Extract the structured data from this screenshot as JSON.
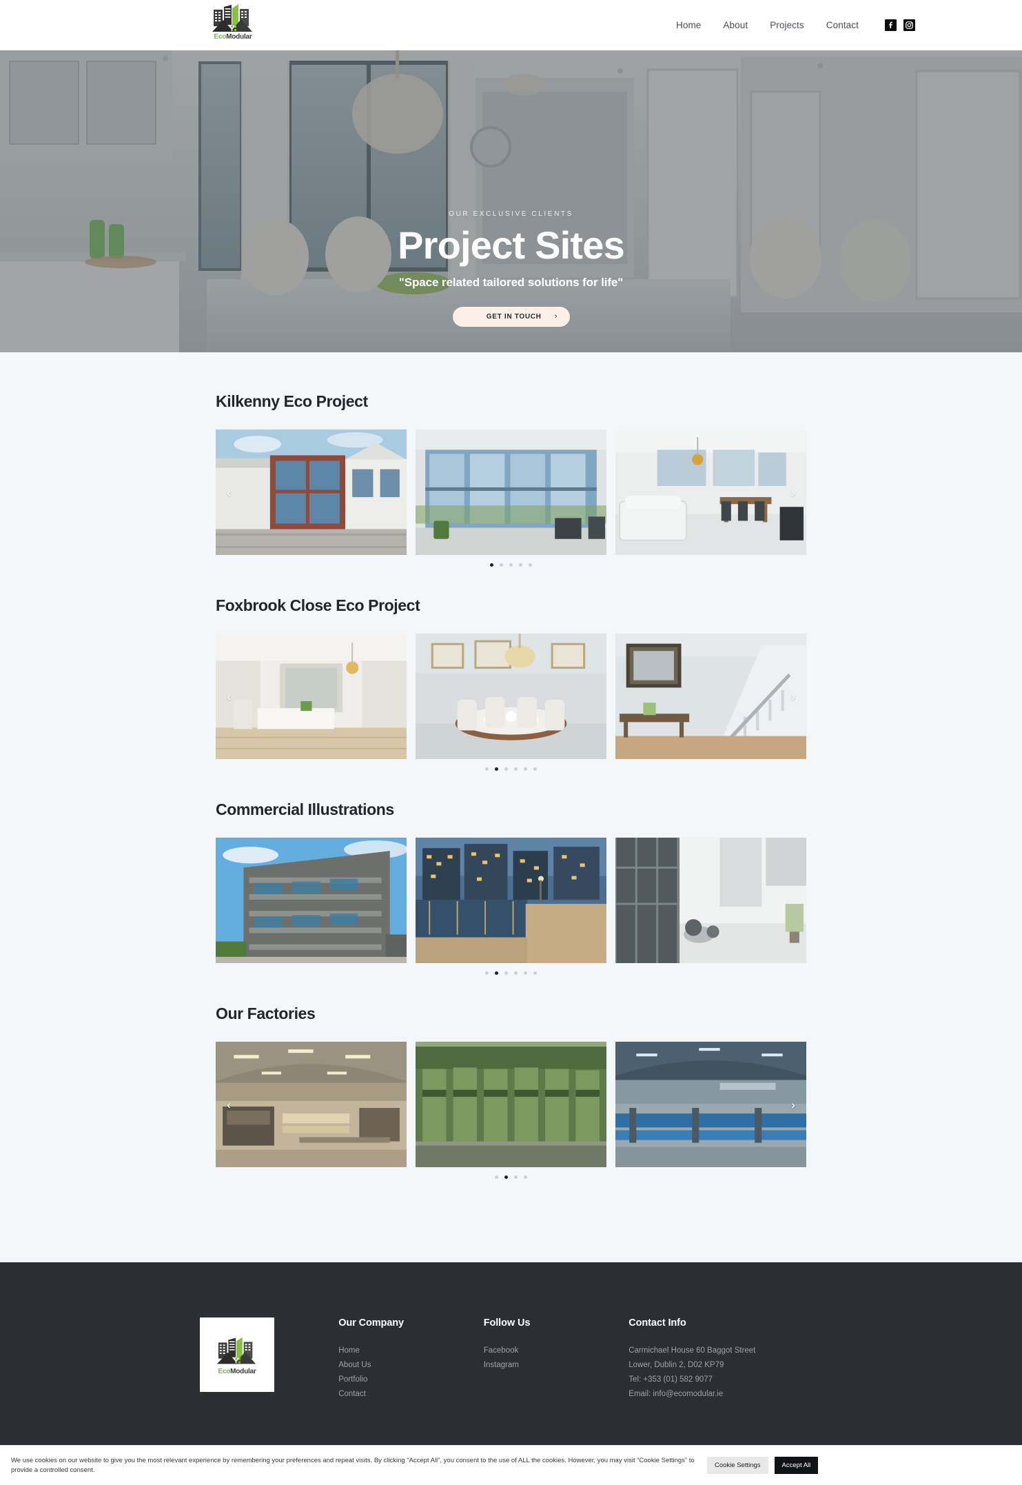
{
  "header": {
    "logo": {
      "eco": "Eco",
      "modular": "Modular",
      "alt": "EcoModular logo"
    },
    "nav": [
      {
        "label": "Home"
      },
      {
        "label": "About"
      },
      {
        "label": "Projects"
      },
      {
        "label": "Contact"
      }
    ],
    "social": [
      {
        "name": "facebook-icon",
        "label": "Facebook"
      },
      {
        "name": "instagram-icon",
        "label": "Instagram"
      }
    ]
  },
  "hero": {
    "eyebrow": "OUR EXCLUSIVE CLIENTS",
    "title": "Project Sites",
    "tagline": "\"Space related tailored solutions for life\"",
    "cta_label": "GET IN TOUCH",
    "cta_chevron": "›",
    "overlay_color": "#3a4046"
  },
  "projects": [
    {
      "title": "Kilkenny Eco Project",
      "dots_total": 5,
      "dots_active": 0,
      "show_prev": true,
      "show_next": true,
      "slides": [
        {
          "caption": "Kilkenny eco building exterior with red framed glass facade"
        },
        {
          "caption": "Large glazed entrance hall interior with greenery"
        },
        {
          "caption": "Bright open plan white living room with pendant lamp"
        }
      ]
    },
    {
      "title": "Foxbrook Close Eco Project",
      "dots_total": 6,
      "dots_active": 1,
      "show_prev": true,
      "show_next": true,
      "slides": [
        {
          "caption": "White kitchen and living area with wooden floor"
        },
        {
          "caption": "Dining room set for dinner under chandelier"
        },
        {
          "caption": "Hallway with staircase, mirror and console table"
        }
      ]
    },
    {
      "title": "Commercial Illustrations",
      "dots_total": 6,
      "dots_active": 1,
      "show_prev": false,
      "show_next": false,
      "slides": [
        {
          "caption": "Modern apartment block with balconies and blue sky"
        },
        {
          "caption": "Waterfront commercial development at dusk"
        },
        {
          "caption": "Glass walled corridor in commercial building"
        }
      ]
    },
    {
      "title": "Our Factories",
      "dots_total": 4,
      "dots_active": 1,
      "show_prev": true,
      "show_next": true,
      "slides": [
        {
          "caption": "Timber frame factory floor with machinery"
        },
        {
          "caption": "Green press machines on factory production line"
        },
        {
          "caption": "Industrial hall with long blue assembly line"
        }
      ]
    }
  ],
  "footer": {
    "company": {
      "heading": "Our Company",
      "links": [
        {
          "label": "Home"
        },
        {
          "label": "About Us"
        },
        {
          "label": "Portfolio"
        },
        {
          "label": "Contact"
        }
      ]
    },
    "follow": {
      "heading": "Follow Us",
      "links": [
        {
          "label": "Facebook"
        },
        {
          "label": "Instagram"
        }
      ]
    },
    "contact": {
      "heading": "Contact Info",
      "lines": [
        "Carmichael House 60 Baggot Street",
        "Lower, Dublin 2, D02 KP79",
        "Tel: +353 (01) 582 9077",
        "Email: info@ecomodular.ie"
      ]
    }
  },
  "cookie": {
    "text": "We use cookies on our website to give you the most relevant experience by remembering your preferences and repeat visits. By clicking “Accept All”, you consent to the use of ALL the cookies. However, you may visit “Cookie Settings” to provide a controlled consent.",
    "settings_label": "Cookie Settings",
    "accept_label": "Accept All"
  },
  "theme": {
    "page_bg": "#f4f7fa",
    "footer_bg": "#2b2f33",
    "accent_green": "#7ab648",
    "cta_bg": "#faf0e8",
    "text_dark": "#22262a"
  }
}
